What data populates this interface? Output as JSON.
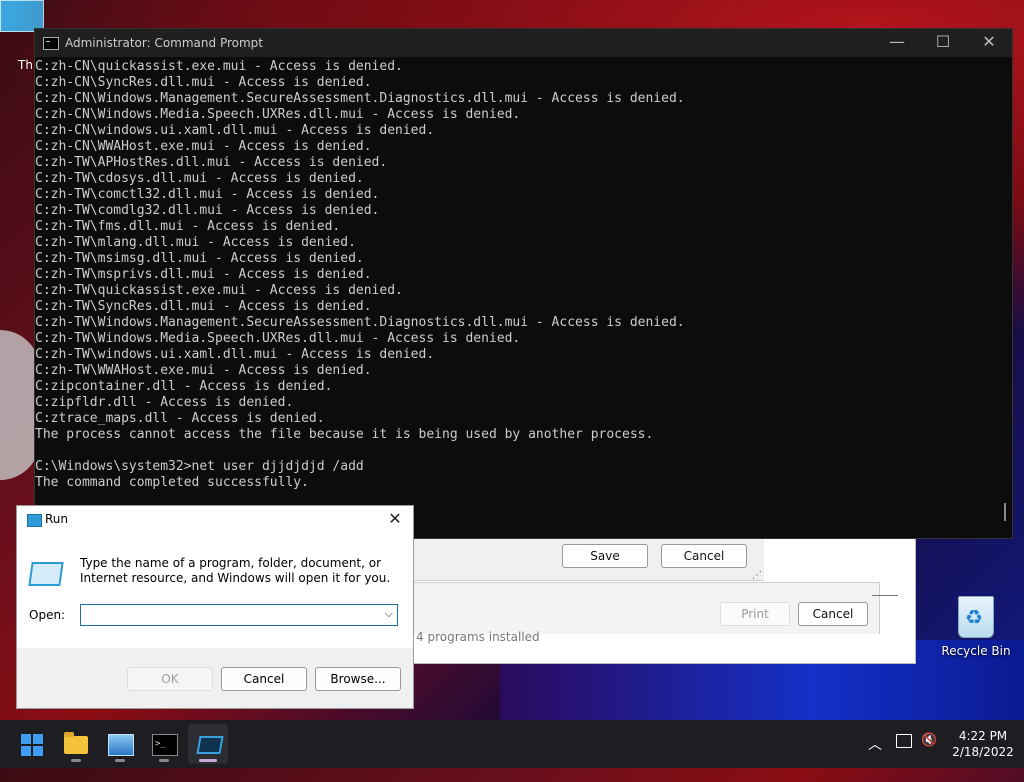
{
  "desktop": {
    "top_icon_label": "Th",
    "recycle_bin_label": "Recycle Bin"
  },
  "cmd": {
    "title": "Administrator: Command Prompt",
    "lines": [
      "C:zh-CN\\quickassist.exe.mui - Access is denied.",
      "C:zh-CN\\SyncRes.dll.mui - Access is denied.",
      "C:zh-CN\\Windows.Management.SecureAssessment.Diagnostics.dll.mui - Access is denied.",
      "C:zh-CN\\Windows.Media.Speech.UXRes.dll.mui - Access is denied.",
      "C:zh-CN\\windows.ui.xaml.dll.mui - Access is denied.",
      "C:zh-CN\\WWAHost.exe.mui - Access is denied.",
      "C:zh-TW\\APHostRes.dll.mui - Access is denied.",
      "C:zh-TW\\cdosys.dll.mui - Access is denied.",
      "C:zh-TW\\comctl32.dll.mui - Access is denied.",
      "C:zh-TW\\comdlg32.dll.mui - Access is denied.",
      "C:zh-TW\\fms.dll.mui - Access is denied.",
      "C:zh-TW\\mlang.dll.mui - Access is denied.",
      "C:zh-TW\\msimsg.dll.mui - Access is denied.",
      "C:zh-TW\\msprivs.dll.mui - Access is denied.",
      "C:zh-TW\\quickassist.exe.mui - Access is denied.",
      "C:zh-TW\\SyncRes.dll.mui - Access is denied.",
      "C:zh-TW\\Windows.Management.SecureAssessment.Diagnostics.dll.mui - Access is denied.",
      "C:zh-TW\\Windows.Media.Speech.UXRes.dll.mui - Access is denied.",
      "C:zh-TW\\windows.ui.xaml.dll.mui - Access is denied.",
      "C:zh-TW\\WWAHost.exe.mui - Access is denied.",
      "C:zipcontainer.dll - Access is denied.",
      "C:zipfldr.dll - Access is denied.",
      "C:ztrace_maps.dll - Access is denied.",
      "The process cannot access the file because it is being used by another process.",
      "",
      "C:\\Windows\\system32>net user djjdjdjd /add",
      "The command completed successfully."
    ]
  },
  "background_windows": {
    "save_label": "Save",
    "cancel_label": "Cancel",
    "print_label": "Print",
    "cancel2_label": "Cancel",
    "programs_text": "4 programs installed"
  },
  "run": {
    "title": "Run",
    "description": "Type the name of a program, folder, document, or Internet resource, and Windows will open it for you.",
    "open_label": "Open:",
    "open_value": "",
    "ok_label": "OK",
    "cancel_label": "Cancel",
    "browse_label": "Browse..."
  },
  "taskbar": {
    "time": "4:22 PM",
    "date": "2/18/2022"
  }
}
